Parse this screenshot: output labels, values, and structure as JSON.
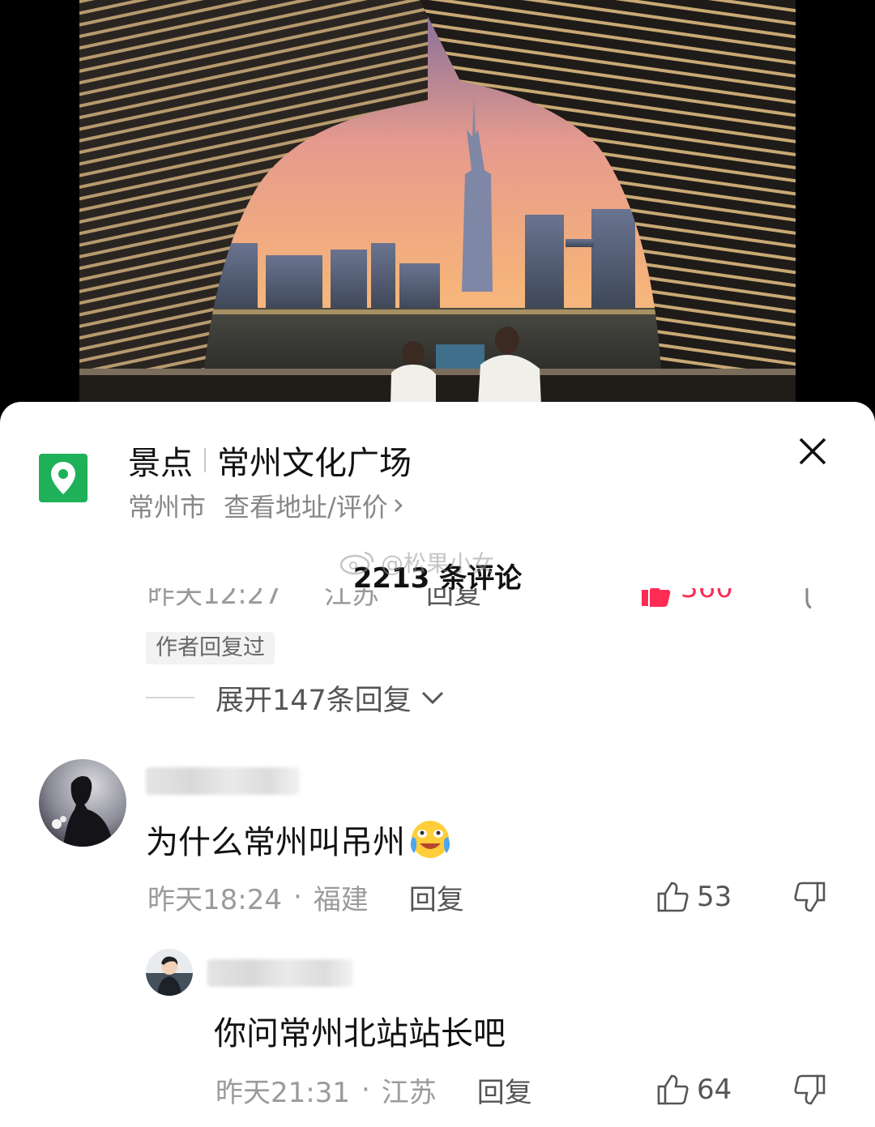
{
  "poi": {
    "category": "景点",
    "name": "常州文化广场",
    "city": "常州市",
    "link_text": "查看地址/评价"
  },
  "comments_header": {
    "count_label": "2213 条评论",
    "watermark": "@松果小女"
  },
  "previous_comment": {
    "author_tag": "作者回复过",
    "expand_label": "展开147条回复"
  },
  "comments": [
    {
      "text": "为什么常州叫吊州",
      "time": "昨天18:24",
      "location": "福建",
      "reply_label": "回复",
      "likes": "53"
    },
    {
      "text": "你问常州北站站长吧",
      "time": "昨天21:31",
      "location": "江苏",
      "reply_label": "回复",
      "likes": "64"
    }
  ],
  "separator_dot": "·",
  "icons": {
    "poi": "location-pin-icon",
    "close": "close-icon",
    "like": "thumbs-up-icon",
    "dislike": "thumbs-down-icon",
    "expand": "chevron-down-icon",
    "emoji": "crying-laughing-emoji-icon"
  },
  "colors": {
    "poi_green": "#1fb15a",
    "like_red": "#fe2c55"
  }
}
